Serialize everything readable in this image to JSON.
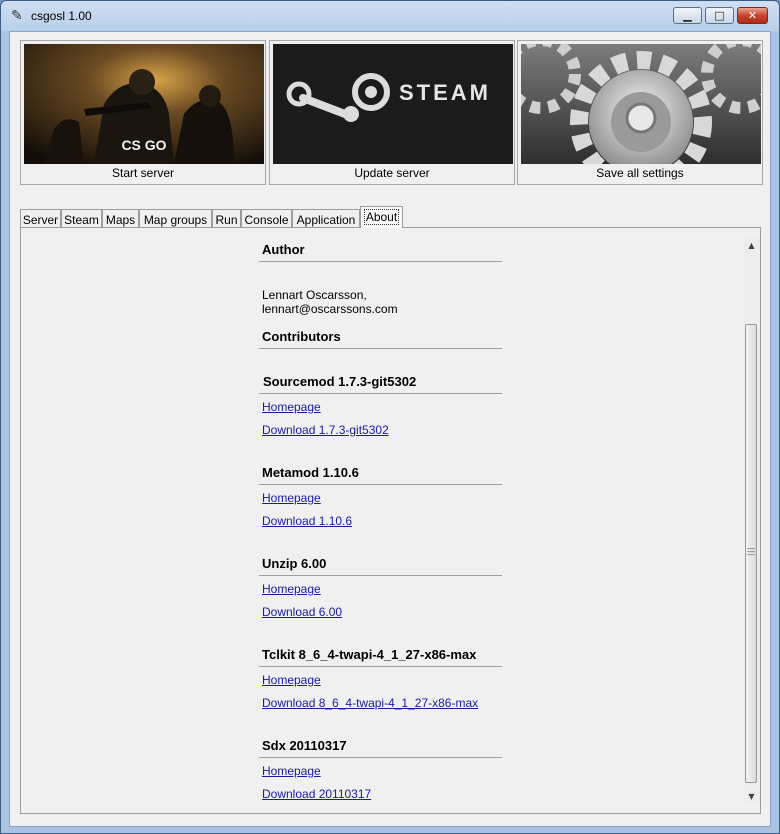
{
  "window": {
    "title": "csgosl 1.00",
    "app_icon": "feather-icon",
    "controls": {
      "minimize": "minimize-icon",
      "maximize": "maximize-icon",
      "close": "close-icon"
    }
  },
  "tiles": [
    {
      "caption": "Start server",
      "image": "csgo-image",
      "logo_text": "CS GO"
    },
    {
      "caption": "Update server",
      "image": "steam-image",
      "logo_text": "STEAM"
    },
    {
      "caption": "Save all settings",
      "image": "gears-image"
    }
  ],
  "tabs": [
    "Server",
    "Steam",
    "Maps",
    "Map groups",
    "Run",
    "Console",
    "Application",
    "About"
  ],
  "active_tab": "About",
  "about": {
    "author_title": "Author",
    "author": "Lennart Oscarsson, lennart@oscarssons.com",
    "contributors_title": "Contributors",
    "components": [
      {
        "name": "Sourcemod 1.7.3-git5302",
        "homepage": "Homepage",
        "download": "Download 1.7.3-git5302"
      },
      {
        "name": "Metamod 1.10.6",
        "homepage": "Homepage",
        "download": "Download 1.10.6"
      },
      {
        "name": "Unzip 6.00",
        "homepage": "Homepage",
        "download": "Download 6.00"
      },
      {
        "name": "Tclkit 8_6_4-twapi-4_1_27-x86-max",
        "homepage": "Homepage",
        "download": "Download 8_6_4-twapi-4_1_27-x86-max"
      },
      {
        "name": "Sdx 20110317",
        "homepage": "Homepage",
        "download": "Download 20110317"
      }
    ]
  },
  "colors": {
    "link": "#1a1aa6",
    "frame": "#a9c3e3",
    "client": "#f0f0f0"
  }
}
